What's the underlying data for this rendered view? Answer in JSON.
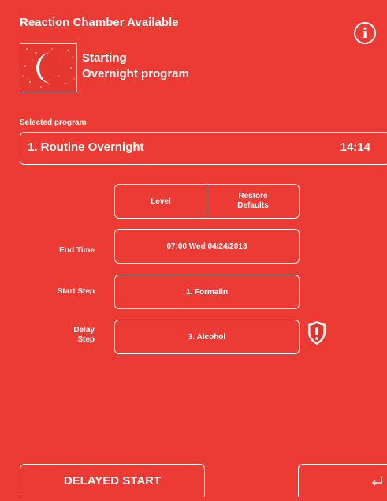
{
  "header": {
    "title": "Reaction Chamber Available",
    "status_line1": "Starting",
    "status_line2": "Overnight program",
    "info_icon": "info-icon",
    "moon_icon": "moon-icon"
  },
  "selected_program": {
    "label": "Selected program",
    "name": "1. Routine Overnight",
    "time": "14:14"
  },
  "buttons": {
    "level": "Level",
    "restore_line1": "Restore",
    "restore_line2": "Defaults"
  },
  "fields": {
    "end_time": {
      "label": "End Time",
      "value": "07:00  Wed 04/24/2013"
    },
    "start_step": {
      "label": "Start Step",
      "value": "1. Formalin"
    },
    "delay_step": {
      "label_line1": "Delay",
      "label_line2": "Step",
      "value": "3. Alcohol",
      "warning_icon": "warning-shield-icon"
    }
  },
  "footer": {
    "delayed_start": "DELAYED START",
    "back_icon": "return-arrow-icon"
  },
  "colors": {
    "background": "#ec3b34",
    "foreground": "#ffffff",
    "warning_red": "#e2302a"
  }
}
